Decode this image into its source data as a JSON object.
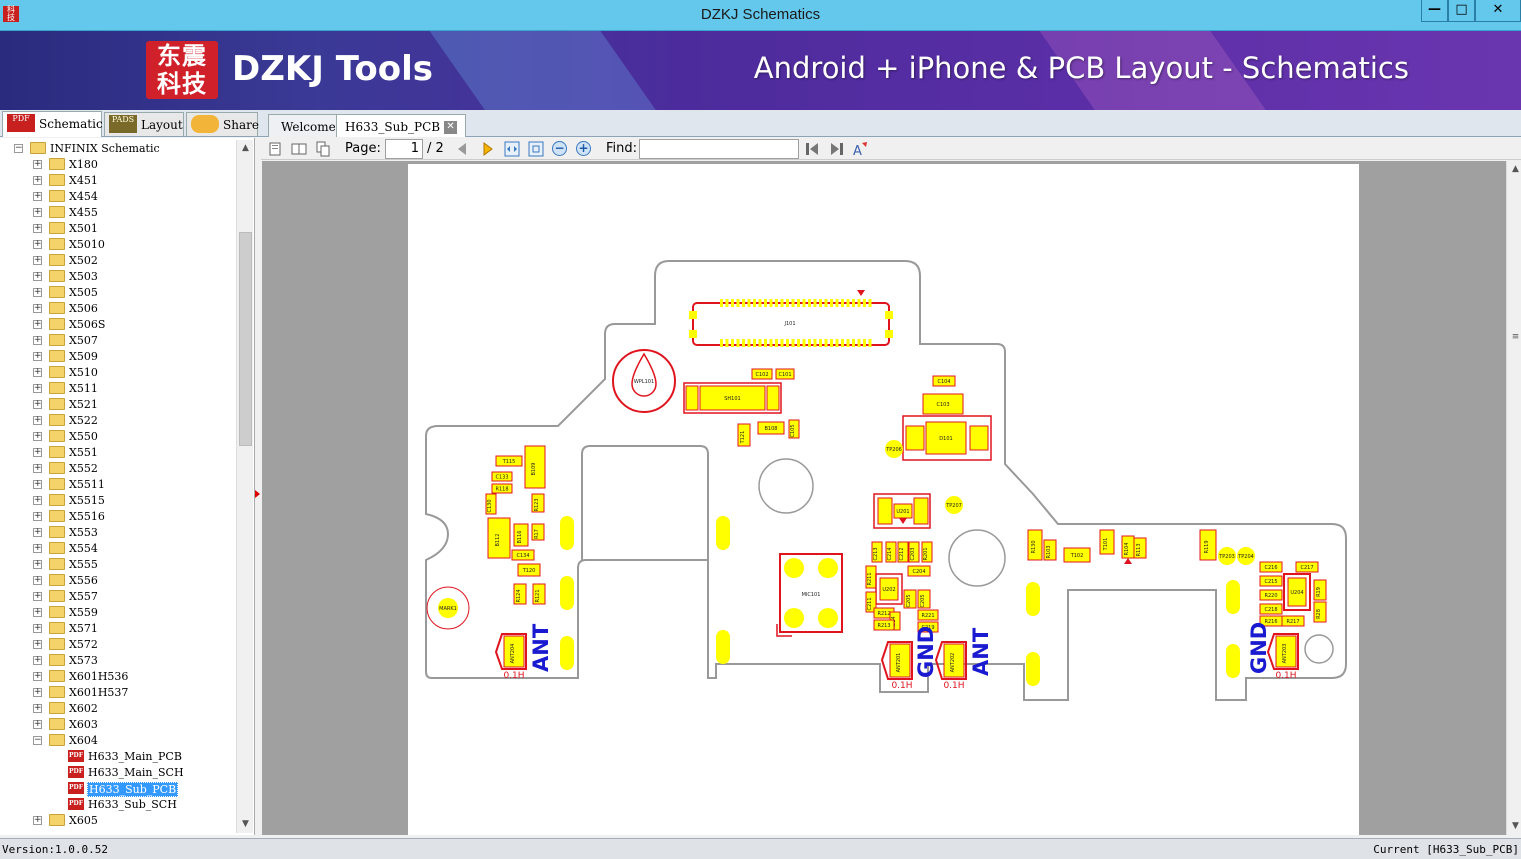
{
  "window": {
    "title": "DZKJ Schematics",
    "minimize": "—",
    "maximize": "□",
    "close": "✕"
  },
  "banner": {
    "logo_text": "东震科技",
    "brand": "DZKJ Tools",
    "slogan": "Android + iPhone & PCB Layout - Schematics"
  },
  "left_tabs": [
    {
      "label": "Schematic",
      "icon": "pdf-icon",
      "icon_text": "PDF"
    },
    {
      "label": "Layout",
      "icon": "pads-icon",
      "icon_text": "PADS"
    },
    {
      "label": "Share",
      "icon": "cloud-share-icon",
      "icon_text": ""
    }
  ],
  "doc_tabs": [
    {
      "label": "Welcome"
    },
    {
      "label": "H633_Sub_PCB",
      "close": "✕"
    }
  ],
  "tree": {
    "root": "INFINIX Schematic",
    "folders": [
      "X180",
      "X451",
      "X454",
      "X455",
      "X501",
      "X5010",
      "X502",
      "X503",
      "X505",
      "X506",
      "X506S",
      "X507",
      "X509",
      "X510",
      "X511",
      "X521",
      "X522",
      "X550",
      "X551",
      "X552",
      "X5511",
      "X5515",
      "X5516",
      "X553",
      "X554",
      "X555",
      "X556",
      "X557",
      "X559",
      "X571",
      "X572",
      "X573",
      "X601H536",
      "X601H537",
      "X602",
      "X603",
      "X604"
    ],
    "expanded_folder": "X604",
    "files": [
      "H633_Main_PCB",
      "H633_Main_SCH",
      "H633_Sub_PCB",
      "H633_Sub_SCH"
    ],
    "selected_file": "H633_Sub_PCB",
    "after": [
      "X605"
    ]
  },
  "toolbar": {
    "page_label": "Page:",
    "page_current": "1",
    "page_total": "/ 2",
    "find_label": "Find:",
    "find_value": ""
  },
  "pcb": {
    "ant_labels": [
      "ANT",
      "ANT"
    ],
    "gnd_labels": [
      "GND",
      "GND"
    ],
    "components": [
      "J101",
      "WPL101",
      "SH101",
      "C102",
      "C101",
      "T121",
      "B108",
      "C105",
      "C104",
      "C103",
      "D101",
      "TP206",
      "T115",
      "B109",
      "C133",
      "R118",
      "C130",
      "R123",
      "B112",
      "B116",
      "R17",
      "C134",
      "T120",
      "R124",
      "R121",
      "MARK1",
      "ANT204",
      "U201",
      "TP207",
      "C213",
      "C214",
      "C212",
      "C203",
      "R201",
      "C204",
      "MIC101",
      "R211",
      "U202",
      "C211",
      "R212",
      "R214",
      "R213",
      "C205",
      "R221",
      "C219",
      "ANT201",
      "ANT202",
      "R130",
      "R103",
      "T102",
      "T101",
      "R104",
      "R113",
      "R119",
      "TP203",
      "TP204",
      "C216",
      "C217",
      "C215",
      "R220",
      "C218",
      "U204",
      "R19",
      "R28",
      "R216",
      "R217",
      "ANT203"
    ],
    "ant_pad_label": "0.1H"
  },
  "status": {
    "version": "Version:1.0.0.52",
    "current": "Current [H633_Sub_PCB]"
  },
  "colors": {
    "titlebar": "#64c7ec",
    "pcb_outline": "#999999",
    "pcb_red": "#e0141e",
    "pcb_yellow": "#ffff00",
    "pcb_blue": "#1a1ad0",
    "selection": "#3399ff"
  }
}
